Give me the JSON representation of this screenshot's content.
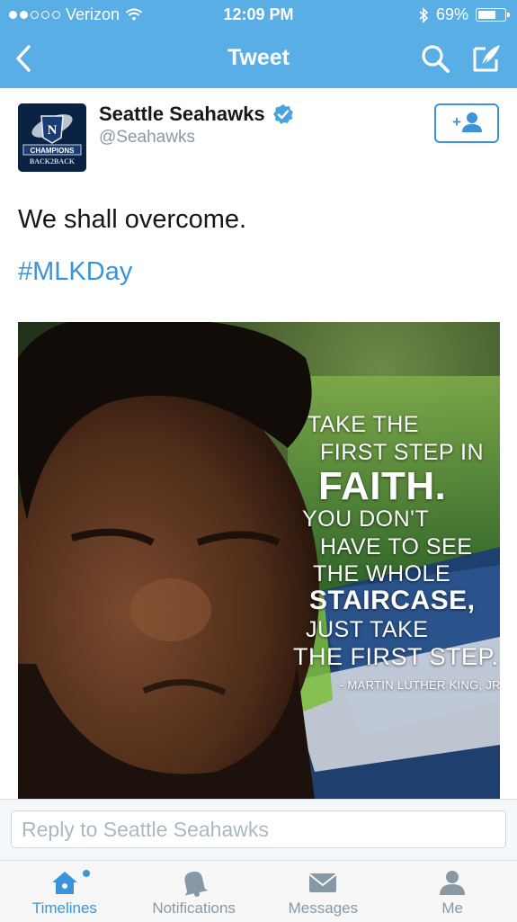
{
  "status_bar": {
    "carrier": "Verizon",
    "time": "12:09 PM",
    "battery": "69%",
    "battery_level": 0.69,
    "signal_bars_filled": 2,
    "signal_bars_total": 5,
    "wifi_icon": "wifi-icon",
    "bluetooth_icon": "bluetooth-icon"
  },
  "nav": {
    "title": "Tweet",
    "back_icon": "chevron-left-icon",
    "search_icon": "search-icon",
    "compose_icon": "compose-icon"
  },
  "tweet": {
    "author_name": "Seattle Seahawks",
    "handle": "@Seahawks",
    "verified": true,
    "avatar": {
      "line1": "CHAMPIONS",
      "line2": "BACK2BACK"
    },
    "follow_icon": "follow-user-icon",
    "text": "We shall overcome.",
    "hashtag": "#MLKDay",
    "media": {
      "quote_lines": [
        "TAKE THE",
        "FIRST STEP IN",
        "FAITH.",
        "YOU DON'T",
        "HAVE TO SEE",
        "THE WHOLE",
        "STAIRCASE,",
        "JUST TAKE",
        "THE FIRST STEP."
      ],
      "attribution": "- MARTIN LUTHER KING, JR."
    }
  },
  "reply": {
    "placeholder": "Reply to Seattle Seahawks",
    "value": ""
  },
  "tabs": [
    {
      "label": "Timelines",
      "icon": "home-icon",
      "active": true,
      "has_badge": true
    },
    {
      "label": "Notifications",
      "icon": "bell-icon",
      "active": false
    },
    {
      "label": "Messages",
      "icon": "envelope-icon",
      "active": false
    },
    {
      "label": "Me",
      "icon": "person-icon",
      "active": false
    }
  ],
  "colors": {
    "header_bg": "#5aaee6",
    "link_blue": "#3b94d9",
    "text_gray": "#8899a6",
    "verified_blue": "#4aa3df"
  }
}
